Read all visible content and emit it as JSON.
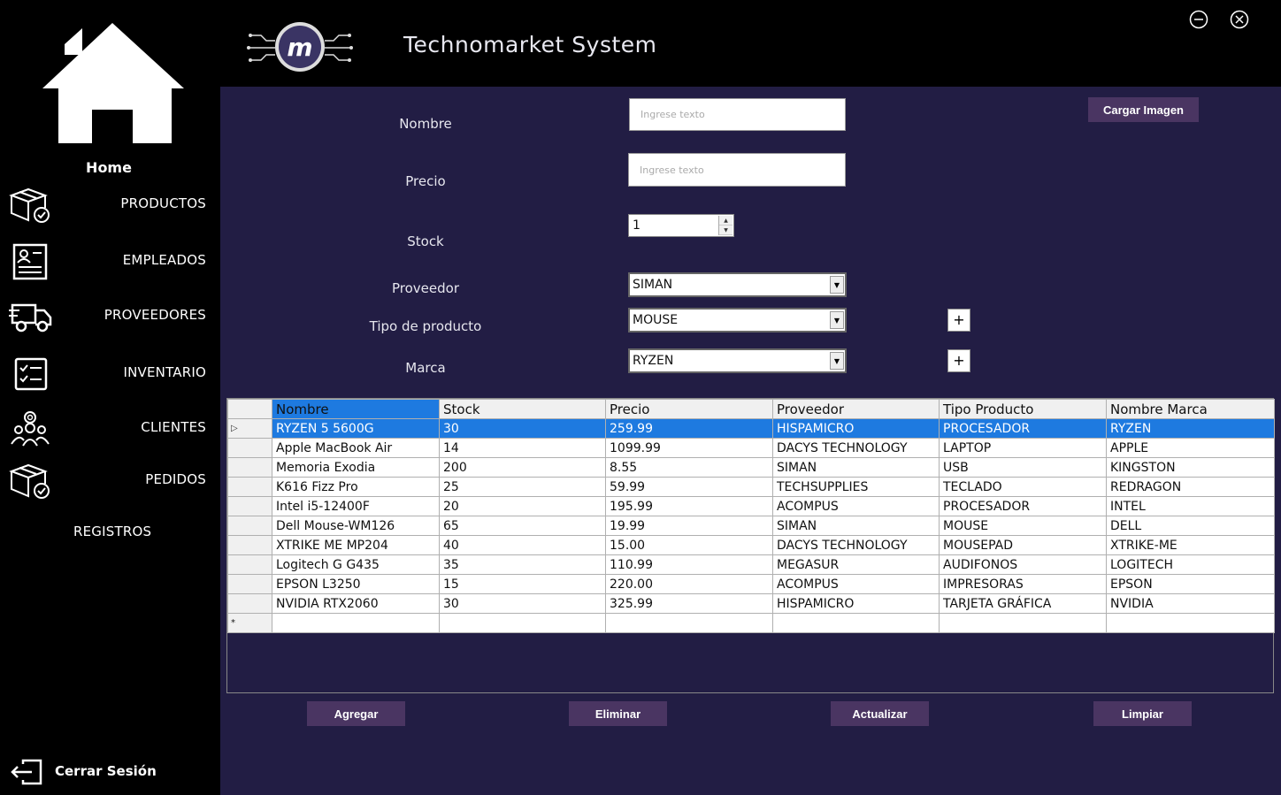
{
  "app": {
    "title": "Technomarket System"
  },
  "sidebar": {
    "home_label": "Home",
    "items": [
      {
        "label": "PRODUCTOS",
        "icon": "box-check-icon"
      },
      {
        "label": "EMPLEADOS",
        "icon": "document-person-icon"
      },
      {
        "label": "PROVEEDORES",
        "icon": "truck-icon"
      },
      {
        "label": "INVENTARIO",
        "icon": "checklist-icon"
      },
      {
        "label": "CLIENTES",
        "icon": "people-group-icon"
      },
      {
        "label": "PEDIDOS",
        "icon": "box-check-icon"
      },
      {
        "label": "REGISTROS",
        "icon": ""
      }
    ],
    "logout_label": "Cerrar Sesión"
  },
  "form": {
    "nombre_label": "Nombre",
    "precio_label": "Precio",
    "stock_label": "Stock",
    "proveedor_label": "Proveedor",
    "tipo_label": "Tipo de producto",
    "marca_label": "Marca",
    "placeholder": "Ingrese texto",
    "stock_value": "1",
    "proveedor_value": "SIMAN",
    "tipo_value": "MOUSE",
    "marca_value": "RYZEN",
    "plus_label": "+",
    "cargar_imagen": "Cargar Imagen"
  },
  "grid": {
    "columns": [
      "Nombre",
      "Stock",
      "Precio",
      "Proveedor",
      "Tipo Producto",
      "Nombre Marca"
    ],
    "rows": [
      [
        "RYZEN 5 5600G",
        "30",
        "259.99",
        "HISPAMICRO",
        "PROCESADOR",
        "RYZEN"
      ],
      [
        "Apple MacBook Air",
        "14",
        "1099.99",
        "DACYS TECHNOLOGY",
        "LAPTOP",
        "APPLE"
      ],
      [
        "Memoria Exodia",
        "200",
        "8.55",
        "SIMAN",
        "USB",
        "KINGSTON"
      ],
      [
        "K616 Fizz Pro",
        "25",
        "59.99",
        "TECHSUPPLIES",
        "TECLADO",
        "REDRAGON"
      ],
      [
        "Intel i5-12400F",
        "20",
        "195.99",
        "ACOMPUS",
        "PROCESADOR",
        "INTEL"
      ],
      [
        "Dell Mouse-WM126",
        "65",
        "19.99",
        "SIMAN",
        "MOUSE",
        "DELL"
      ],
      [
        "XTRIKE ME MP204",
        "40",
        "15.00",
        "DACYS TECHNOLOGY",
        "MOUSEPAD",
        "XTRIKE-ME"
      ],
      [
        "Logitech G G435",
        "35",
        "110.99",
        "MEGASUR",
        "AUDIFONOS",
        "LOGITECH"
      ],
      [
        "EPSON L3250",
        "15",
        "220.00",
        "ACOMPUS",
        "IMPRESORAS",
        "EPSON"
      ],
      [
        "NVIDIA RTX2060",
        "30",
        "325.99",
        "HISPAMICRO",
        "TARJETA GRÁFICA",
        "NVIDIA"
      ]
    ],
    "selected_row": 0,
    "new_row_marker": "*"
  },
  "actions": {
    "agregar": "Agregar",
    "eliminar": "Eliminar",
    "actualizar": "Actualizar",
    "limpiar": "Limpiar"
  },
  "colors": {
    "main_bg": "#221d44",
    "button_bg": "#4a3562",
    "selection": "#1e7ae0"
  }
}
